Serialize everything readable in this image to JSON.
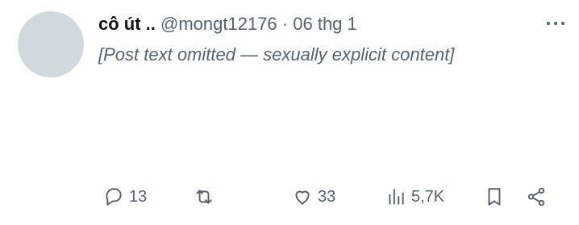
{
  "author": {
    "display_name": "cô út ..",
    "handle": "@mongt12176",
    "separator": "·",
    "date": "06 thg 1"
  },
  "post": {
    "text": "[Post text omitted — sexually explicit content]"
  },
  "actions": {
    "replies": "13",
    "reposts": "",
    "likes": "33",
    "views": "5,7K"
  },
  "icons": [
    "reply-icon",
    "repost-icon",
    "like-icon",
    "views-icon",
    "bookmark-icon",
    "share-icon",
    "more-icon"
  ],
  "colors": {
    "text": "#0f1419",
    "secondary": "#536471"
  }
}
